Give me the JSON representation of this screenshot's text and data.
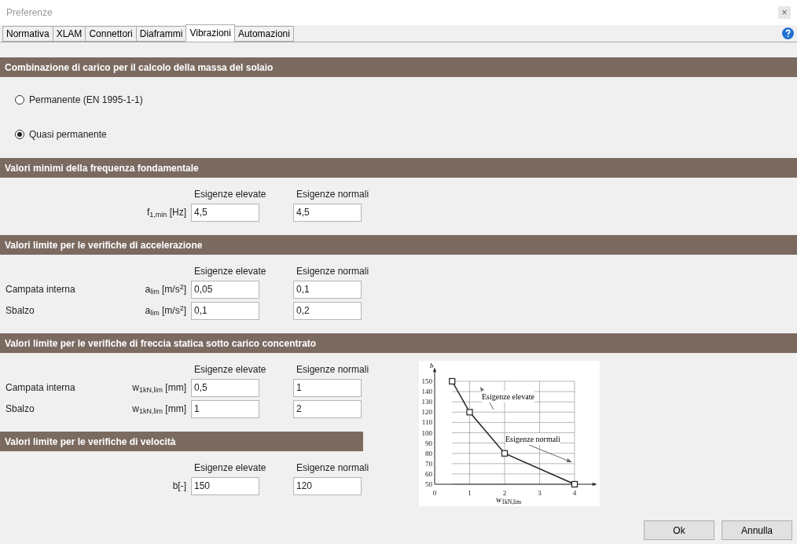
{
  "window": {
    "title": "Preferenze",
    "close": "×"
  },
  "tabs": [
    {
      "label": "Normativa",
      "selected": false
    },
    {
      "label": "XLAM",
      "selected": false
    },
    {
      "label": "Connettori",
      "selected": false
    },
    {
      "label": "Diaframmi",
      "selected": false
    },
    {
      "label": "Vibrazioni",
      "selected": true
    },
    {
      "label": "Automazioni",
      "selected": false
    }
  ],
  "sections": [
    {
      "kind": "radio",
      "title": "Combinazione di carico per il calcolo della massa del solaio",
      "options": [
        {
          "label": "Permanente (EN 1995-1-1)",
          "selected": false
        },
        {
          "label": "Quasi permanente",
          "selected": true
        }
      ]
    },
    {
      "kind": "table",
      "title": "Valori minimi della frequenza fondamentale",
      "columns": [
        "Esigenze elevate",
        "Esigenze normali"
      ],
      "rows": [
        {
          "label": "",
          "unit": "f$_{1,min}$ [Hz]",
          "values": [
            "4,5",
            "4,5"
          ]
        }
      ]
    },
    {
      "kind": "table",
      "title": "Valori limite per le verifiche di accelerazione",
      "columns": [
        "Esigenze elevate",
        "Esigenze normali"
      ],
      "rows": [
        {
          "label": "Campata interna",
          "unit": "a$_{lim}$ [m/s$^{2}$]",
          "values": [
            "0,05",
            "0,1"
          ]
        },
        {
          "label": "Sbalzo",
          "unit": "a$_{lim}$ [m/s$^{2}$]",
          "values": [
            "0,1",
            "0,2"
          ]
        }
      ]
    },
    {
      "kind": "table",
      "title": "Valori limite per le verifiche di freccia statica sotto carico concentrato",
      "columns": [
        "Esigenze elevate",
        "Esigenze normali"
      ],
      "rows": [
        {
          "label": "Campata interna",
          "unit": "w$_{1kN,lim}$ [mm]",
          "values": [
            "0,5",
            "1"
          ]
        },
        {
          "label": "Sbalzo",
          "unit": "w$_{1kN,lim}$ [mm]",
          "values": [
            "1",
            "2"
          ]
        }
      ]
    },
    {
      "kind": "table",
      "title": "Valori limite per le verifiche di velocità",
      "columns": [
        "Esigenze elevate",
        "Esigenze normali"
      ],
      "rows": [
        {
          "label": "",
          "unit": "b[-]",
          "values": [
            "150",
            "120"
          ]
        }
      ]
    }
  ],
  "figure": {
    "chart_data": {
      "type": "line",
      "ylabel": "b",
      "xlabel": "w$_{1kN,lim}$",
      "x": [
        0.5,
        1,
        2,
        4
      ],
      "series": [
        {
          "color": "#222222",
          "marker": "square",
          "values": [
            150,
            120,
            80,
            50
          ]
        }
      ],
      "grid": true,
      "xlim": [
        0,
        4.6
      ],
      "ylim": [
        50,
        162
      ],
      "xticks": [
        0,
        1,
        2,
        3,
        4
      ],
      "yticks": [
        50,
        60,
        70,
        80,
        90,
        100,
        110,
        120,
        130,
        140,
        150
      ],
      "annotations": [
        "Esigenze elevate",
        "Esigenze normali"
      ]
    }
  },
  "buttons": [
    "Ok",
    "Annulla"
  ]
}
